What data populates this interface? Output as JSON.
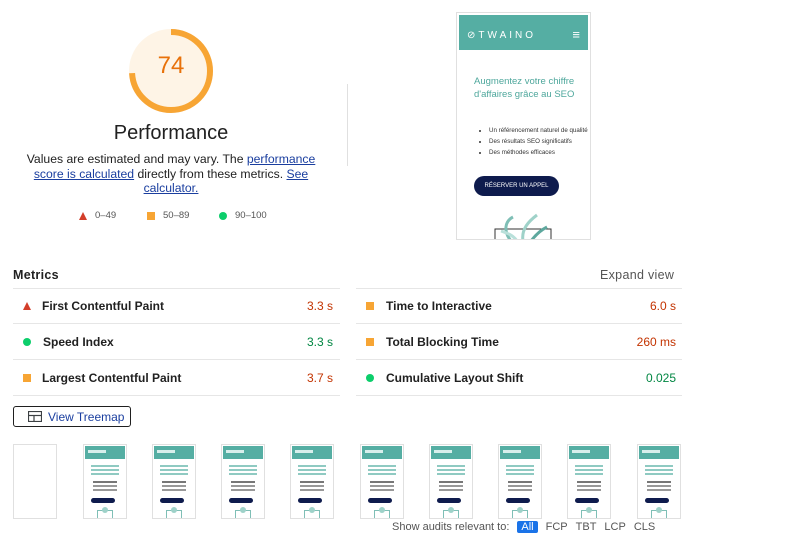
{
  "score": {
    "value": "74",
    "category": "Performance",
    "color": "#f7a534",
    "fraction": 0.74
  },
  "description": {
    "before": "Values are estimated and may vary. The ",
    "link1": "performance score is calculated",
    "middle": " directly from these metrics. ",
    "link2": "See calculator."
  },
  "legend": [
    {
      "icon": "triangle-icon",
      "range": "0–49",
      "color": "#d33e2a"
    },
    {
      "icon": "square-icon",
      "range": "50–89",
      "color": "#f7a534"
    },
    {
      "icon": "circle-icon",
      "range": "90–100",
      "color": "#0cce6b"
    }
  ],
  "screenshot": {
    "logo": "TWAINO",
    "headline": "Augmentez votre chiffre d'affaires grâce au SEO",
    "bullets": [
      "Un référencement naturel de qualité",
      "Des résultats SEO significatifs",
      "Des méthodes efficaces"
    ],
    "cta": "RÉSERVER UN APPEL"
  },
  "metrics": {
    "title": "Metrics",
    "expand": "Expand view",
    "items": [
      {
        "name": "First Contentful Paint",
        "value": "3.3 s",
        "status": "fail"
      },
      {
        "name": "Time to Interactive",
        "value": "6.0 s",
        "status": "average"
      },
      {
        "name": "Speed Index",
        "value": "3.3 s",
        "status": "pass"
      },
      {
        "name": "Total Blocking Time",
        "value": "260 ms",
        "status": "average"
      },
      {
        "name": "Largest Contentful Paint",
        "value": "3.7 s",
        "status": "average"
      },
      {
        "name": "Cumulative Layout Shift",
        "value": "0.025",
        "status": "pass"
      }
    ]
  },
  "treemap_button": "View Treemap",
  "filter": {
    "label": "Show audits relevant to:",
    "options": [
      "All",
      "FCP",
      "TBT",
      "LCP",
      "CLS"
    ]
  }
}
